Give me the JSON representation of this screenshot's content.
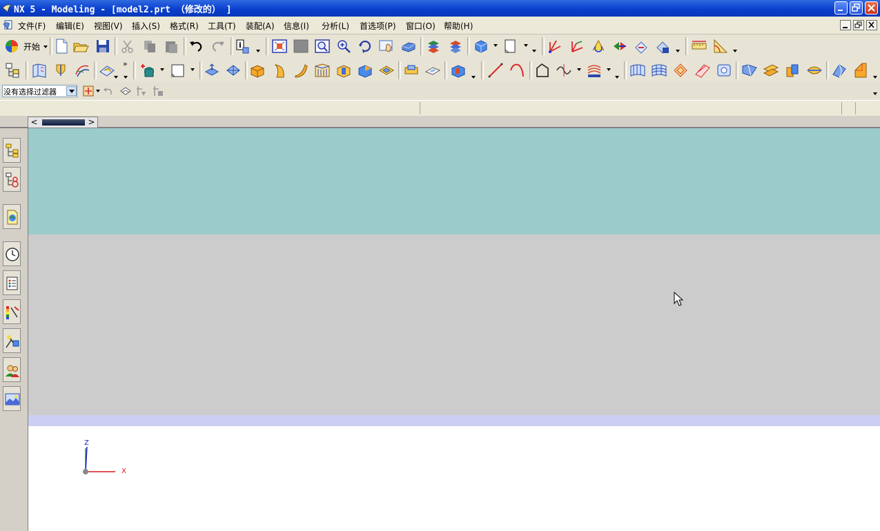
{
  "window": {
    "title": "NX 5 - Modeling - [model2.prt （修改的） ]"
  },
  "menu": {
    "items": [
      {
        "label": "文件(F)"
      },
      {
        "label": "编辑(E)"
      },
      {
        "label": "视图(V)"
      },
      {
        "label": "插入(S)"
      },
      {
        "label": "格式(R)"
      },
      {
        "label": "工具(T)"
      },
      {
        "label": "装配(A)"
      },
      {
        "label": "信息(I)"
      },
      {
        "label": "分析(L)"
      },
      {
        "label": "首选项(P)"
      },
      {
        "label": "窗口(O)"
      },
      {
        "label": "帮助(H)"
      }
    ]
  },
  "toolbar": {
    "start_label": "开始"
  },
  "selection": {
    "filter_value": "没有选择过滤器"
  },
  "triad": {
    "z_label": "Z",
    "x_label": "X",
    "y_color": "#1a9a1a",
    "x_color": "#d81818",
    "z_color": "#2020d0"
  },
  "colors": {
    "title_bar": "#0a3fcf",
    "viewport_top": "#9ccbcb",
    "viewport_mid": "#cccccc",
    "viewport_band": "#cccff3"
  }
}
